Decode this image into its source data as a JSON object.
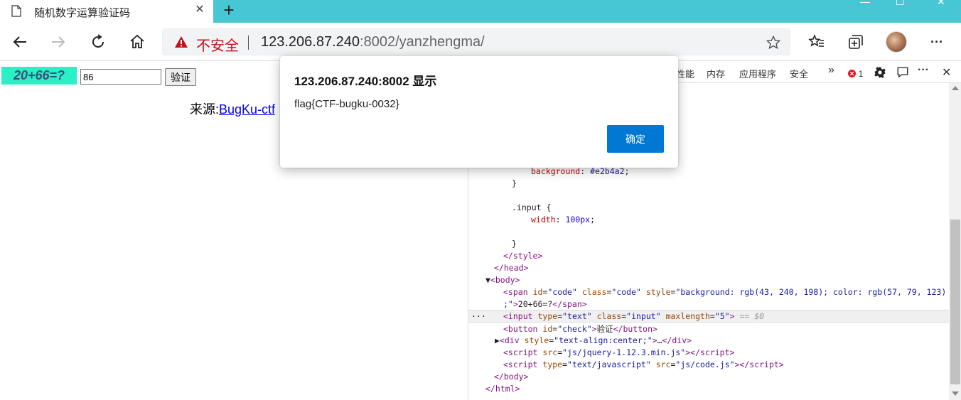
{
  "browser": {
    "tab_title": "随机数字运算验证码",
    "tab_close": "✕",
    "new_tab": "+",
    "insecure_label": "不安全",
    "url_host": "123.206.87.240",
    "url_rest": ":8002/yanzhengma/",
    "more_label": "···"
  },
  "page": {
    "code_text": "20+66=?",
    "answer_value": "86",
    "check_button": "验证",
    "source_label": "来源:",
    "source_link": "BugKu-ctf"
  },
  "devtools": {
    "tabs": [
      "性能",
      "内存",
      "应用程序",
      "安全"
    ],
    "overflow": "»",
    "error_count": "1",
    "more": "···",
    "close": "✕"
  },
  "dialog": {
    "title": "123.206.87.240:8002 显示",
    "message": "flag{CTF-bugku-0032}",
    "ok_label": "确定"
  },
  "colors": {
    "tabstrip": "#47c6d4",
    "code_bg": "#2bf0c6",
    "code_fg": "#394f7b",
    "ok_button": "#0078d4",
    "insecure": "#c50f1f"
  }
}
